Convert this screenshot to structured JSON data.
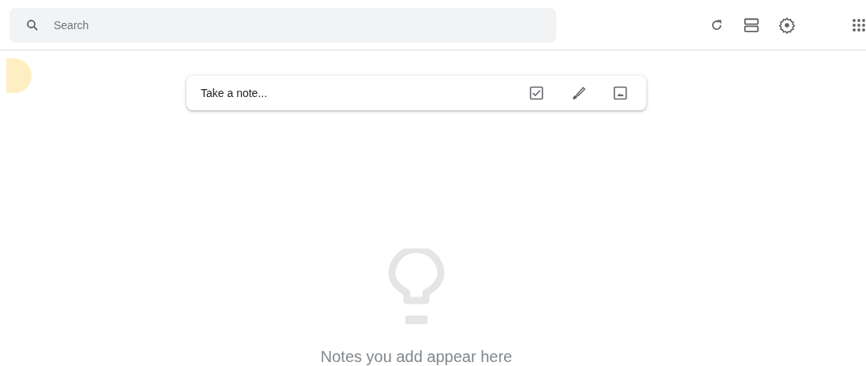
{
  "search": {
    "placeholder": "Search"
  },
  "note_composer": {
    "placeholder": "Take a note..."
  },
  "empty_state": {
    "message": "Notes you add appear here"
  }
}
